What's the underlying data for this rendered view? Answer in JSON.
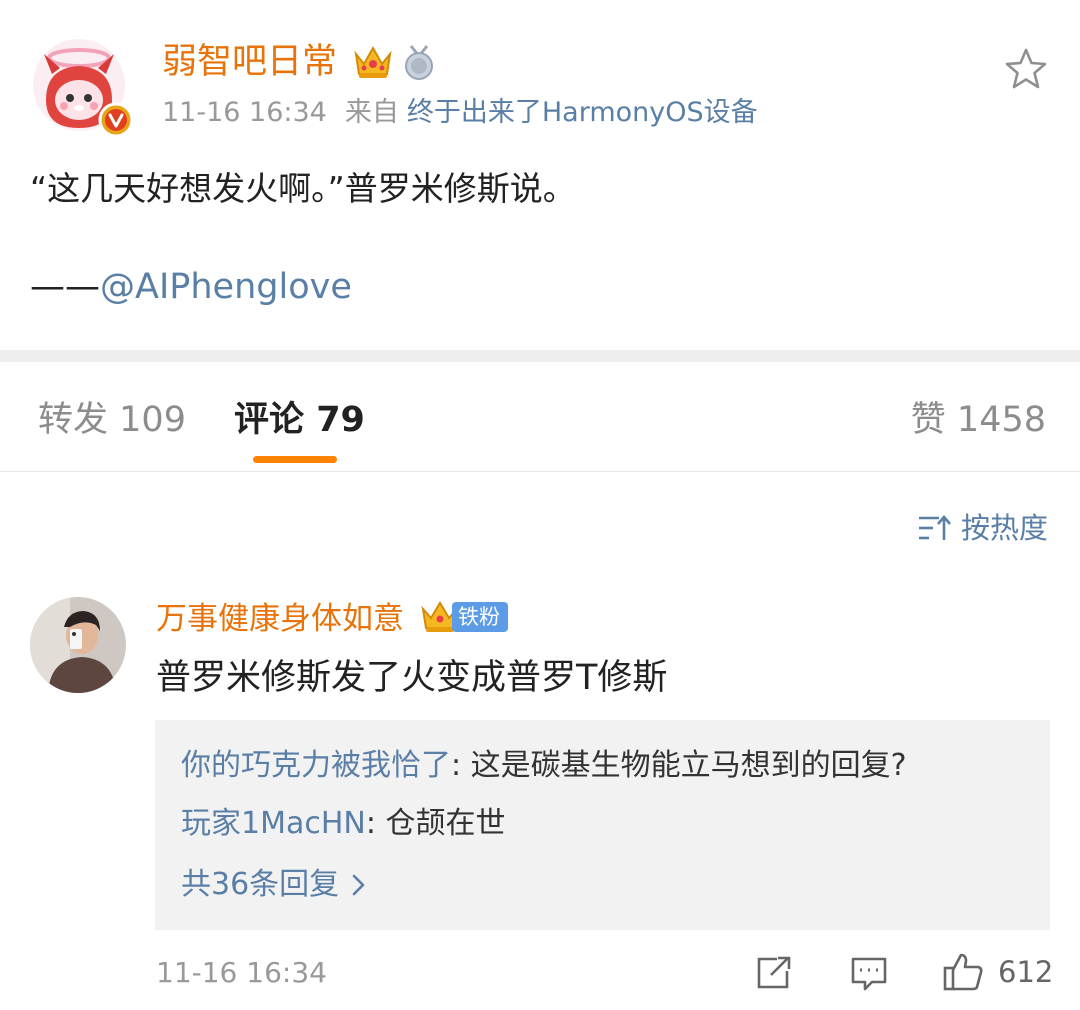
{
  "post": {
    "author": "弱智吧日常",
    "time": "11-16 16:34",
    "source_label": "来自",
    "source_device": "终于出来了HarmonyOS设备",
    "text": "“这几天好想发火啊。”普罗米修斯说。",
    "credit_dash": "——",
    "credit_mention": "@AIPhenglove"
  },
  "tabs": {
    "repost_label": "转发",
    "repost_count": "109",
    "comment_label": "评论",
    "comment_count": "79",
    "like_label": "赞",
    "like_count": "1458",
    "active": "comment",
    "active_color": "#ff8200"
  },
  "sort": {
    "label": "按热度"
  },
  "comment": {
    "user": "万事健康身体如意",
    "badge": "铁粉",
    "text": "普罗米修斯发了火变成普罗T修斯",
    "replies": [
      {
        "user": "你的巧克力被我恰了",
        "text": ": 这是碳基生物能立马想到的回复?"
      },
      {
        "user": "玩家1MacHN",
        "text": ": 仓颉在世"
      }
    ],
    "more_replies": "共36条回复",
    "time": "11-16 16:34",
    "like_count": "612"
  },
  "colors": {
    "name_orange": "#e8730a",
    "link_blue": "#5a7fa6",
    "badge_blue": "#5c9be6",
    "reply_bg": "#f2f2f2"
  }
}
